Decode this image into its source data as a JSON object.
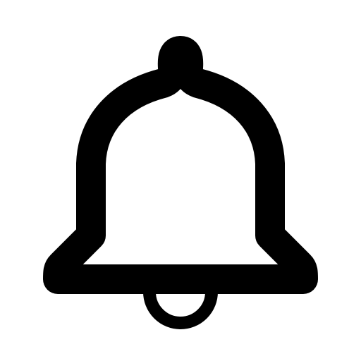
{
  "icon": {
    "name": "bell-icon",
    "style": "outline",
    "color": "#000000",
    "background": "#ffffff"
  }
}
